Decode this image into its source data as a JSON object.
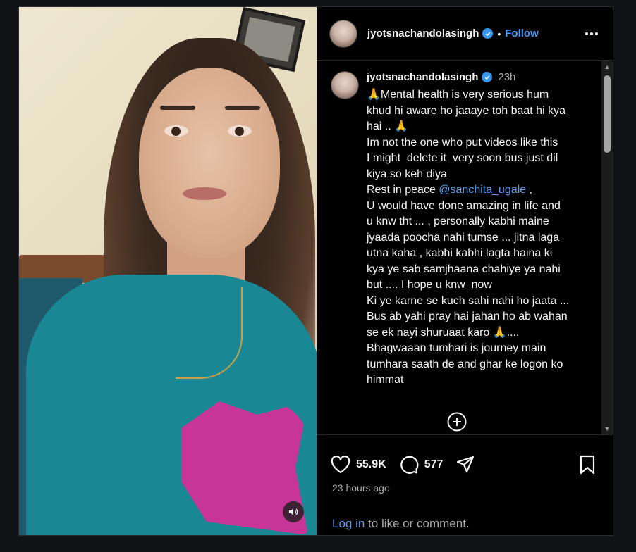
{
  "post": {
    "username": "jyotsnachandolasingh",
    "follow_label": "Follow",
    "dot": "•",
    "time_short": "23h",
    "caption_lines": [
      "🙏Mental health is very serious hum",
      "khud hi aware ho jaaaye toh baat hi kya",
      "hai .. 🙏",
      "Im not the one who put videos like this",
      "I might  delete it  very soon bus just dil",
      "kiya so keh diya",
      "Rest in peace ",
      "U would have done amazing in life and",
      "u knw tht ... , personally kabhi maine",
      "jyaada poocha nahi tumse ... jitna laga",
      "utna kaha , kabhi kabhi lagta haina ki",
      "kya ye sab samjhaana chahiye ya nahi",
      "but .... I hope u knw  now",
      "Ki ye karne se kuch sahi nahi ho jaata ...",
      "Bus ab yahi pray hai jahan ho ab wahan",
      "se ek nayi shuruaat karo 🙏....",
      "Bhagwaaan tumhari is journey main",
      "tumhara saath de and ghar ke logon ko",
      "himmat"
    ],
    "mention": "@sanchita_ugale",
    "mention_suffix": " ,",
    "likes": "55.9K",
    "comments": "577",
    "time_long": "23 hours ago",
    "login_link": "Log in",
    "login_rest": " to like or comment."
  },
  "icons": {
    "more": "more-options-icon",
    "heart": "heart-icon",
    "comment": "comment-icon",
    "share": "share-icon",
    "bookmark": "bookmark-icon",
    "add": "add-circle-icon",
    "sound": "speaker-icon",
    "verified": "verified-badge-icon"
  },
  "colors": {
    "accent": "#4a9df8",
    "verified": "#3897f0",
    "background": "#000000"
  }
}
